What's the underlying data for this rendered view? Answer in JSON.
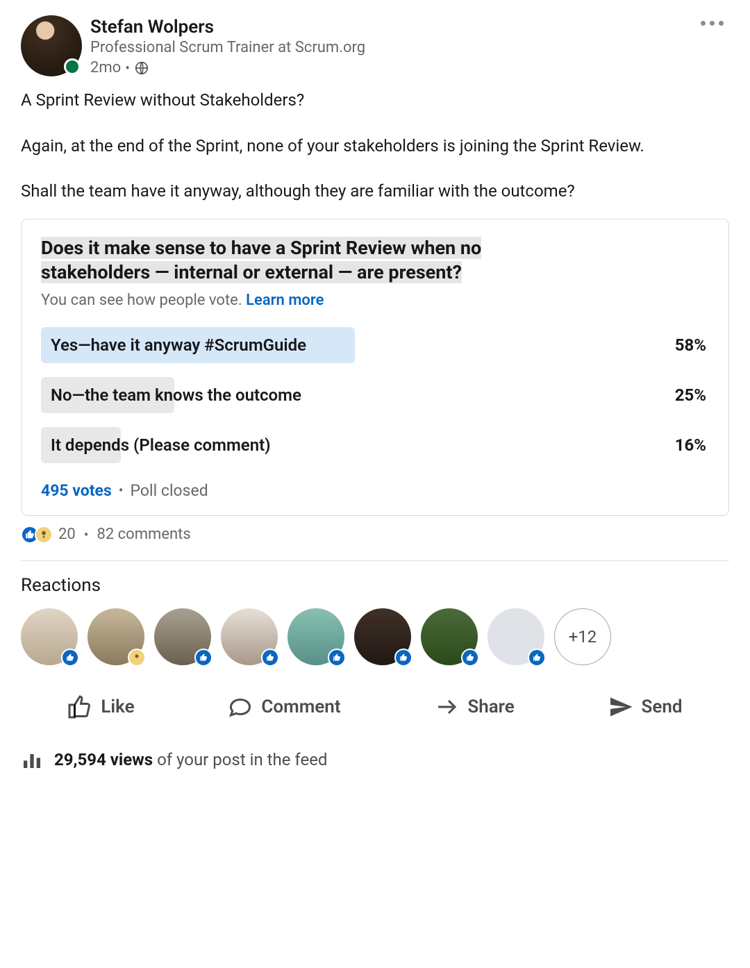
{
  "author": {
    "name": "Stefan Wolpers",
    "headline": "Professional Scrum Trainer at Scrum.org",
    "time": "2mo",
    "visibility": "Public"
  },
  "body": {
    "p1": "A Sprint Review without Stakeholders?",
    "p2": "Again, at the end of the Sprint, none of your stakeholders is joining the Sprint Review.",
    "p3": "Shall the team have it anyway, although they are familiar with the outcome?"
  },
  "poll": {
    "question_a": "Does it make sense to have a Sprint Review when no ",
    "question_b": "stakeholders — internal or external — are present?",
    "sub_text": "You can see how people vote. ",
    "learn_more": "Learn more",
    "options": [
      {
        "label": "Yes—have it anyway #ScrumGuide",
        "pct": "58%",
        "width": 47,
        "color": "blue"
      },
      {
        "label": "No—the team knows the outcome",
        "pct": "25%",
        "width": 20,
        "color": "grey"
      },
      {
        "label": "It depends (Please comment)",
        "pct": "16%",
        "width": 12,
        "color": "grey"
      }
    ],
    "votes": "495 votes",
    "status": "Poll closed"
  },
  "social": {
    "reaction_count": "20",
    "comments": "82 comments"
  },
  "reactions": {
    "heading": "Reactions",
    "more": "+12"
  },
  "actions": {
    "like": "Like",
    "comment": "Comment",
    "share": "Share",
    "send": "Send"
  },
  "analytics": {
    "count": "29,594 views",
    "suffix": " of your post in the feed"
  },
  "chart_data": {
    "type": "bar",
    "title": "Does it make sense to have a Sprint Review when no stakeholders — internal or external — are present?",
    "categories": [
      "Yes—have it anyway #ScrumGuide",
      "No—the team knows the outcome",
      "It depends (Please comment)"
    ],
    "values": [
      58,
      25,
      16
    ],
    "xlabel": "",
    "ylabel": "Percent",
    "ylim": [
      0,
      100
    ],
    "n": 495
  }
}
